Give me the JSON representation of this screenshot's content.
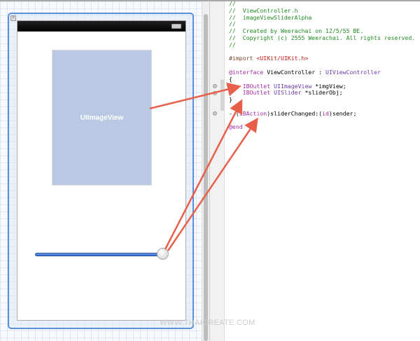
{
  "code": {
    "lines": [
      [
        {
          "t": "//",
          "c": "c"
        }
      ],
      [
        {
          "t": "//  ViewController.h",
          "c": "c"
        }
      ],
      [
        {
          "t": "//  imageViewSliderAlpha",
          "c": "c"
        }
      ],
      [
        {
          "t": "//",
          "c": "c"
        }
      ],
      [
        {
          "t": "//  Created by Weerachai on 12/5/55 BE.",
          "c": "c"
        }
      ],
      [
        {
          "t": "//  Copyright (c) 2555 Weerachai. All rights reserved.",
          "c": "c"
        }
      ],
      [
        {
          "t": "//",
          "c": "c"
        }
      ],
      [],
      [
        {
          "t": "#import ",
          "c": "p"
        },
        {
          "t": "<UIKit/UIKit.h>",
          "c": "s"
        }
      ],
      [],
      [
        {
          "t": "@interface",
          "c": "k"
        },
        {
          "t": " ViewController : "
        },
        {
          "t": "UIViewController",
          "c": "t"
        }
      ],
      [
        {
          "t": "{"
        }
      ],
      [
        {
          "t": "    "
        },
        {
          "t": "IBOutlet",
          "c": "k"
        },
        {
          "t": " "
        },
        {
          "t": "UIImageView",
          "c": "t"
        },
        {
          "t": " *imgView;"
        }
      ],
      [
        {
          "t": "    "
        },
        {
          "t": "IBOutlet",
          "c": "k"
        },
        {
          "t": " "
        },
        {
          "t": "UISlider",
          "c": "t"
        },
        {
          "t": " *sliderObj;"
        }
      ],
      [
        {
          "t": "}"
        }
      ],
      [],
      [
        {
          "t": "- ("
        },
        {
          "t": "IBAction",
          "c": "k"
        },
        {
          "t": ")sliderChanged:("
        },
        {
          "t": "id",
          "c": "k"
        },
        {
          "t": ")sender;"
        }
      ],
      [],
      [
        {
          "t": "@end",
          "c": "k"
        }
      ]
    ]
  },
  "canvas": {
    "image_view_label": "UIImageView",
    "slider_value": 1.0
  },
  "watermark": "WWW.THAICREATE.COM",
  "colors": {
    "arrow": "#e8604c",
    "selection": "#5b8fd8"
  }
}
